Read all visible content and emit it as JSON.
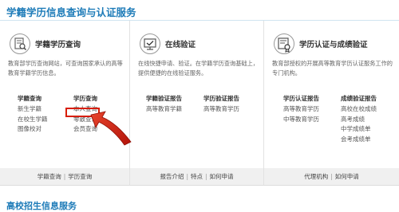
{
  "header": {
    "title": "学籍学历信息查询与认证服务"
  },
  "panels": [
    {
      "title": "学籍学历查询",
      "icon": "document-search-icon",
      "desc": "教育部学历查询网站，可查询国家承认的高等教育学籍学历信息。",
      "columns": [
        {
          "heading": "学籍查询",
          "items": [
            "新生学籍",
            "在校生学籍",
            "图像校对"
          ]
        },
        {
          "heading": "学历查询",
          "items": [
            "本人查询",
            "零散查询",
            "会员查询"
          ]
        }
      ],
      "footer": [
        "学籍查询",
        "学历查询"
      ]
    },
    {
      "title": "在线验证",
      "icon": "monitor-check-icon",
      "desc": "在线快捷申请、验证。在学籍学历查询基础上，提供便捷的在线验证服务。",
      "columns": [
        {
          "heading": "学籍验证报告",
          "items": [
            "高等教育学籍"
          ]
        },
        {
          "heading": "学历验证报告",
          "items": [
            "高等教育学历"
          ]
        }
      ],
      "footer": [
        "报告介绍",
        "特点",
        "如何申请"
      ]
    },
    {
      "title": "学历认证与成绩验证",
      "icon": "certificate-icon",
      "desc": "教育部授权的开展高等教育学历认证服务工作的专门机构。",
      "columns": [
        {
          "heading": "学历认证报告",
          "items": [
            "高等教育学历",
            "中等教育学历"
          ]
        },
        {
          "heading": "成绩验证报告",
          "items": [
            "高校在校成绩",
            "高考成绩",
            "中学成绩单",
            "会考成绩单"
          ]
        }
      ],
      "footer": [
        "代理机构",
        "如何申请"
      ]
    }
  ],
  "next_section": {
    "title": "高校招生信息服务"
  },
  "colors": {
    "brand": "#1d7bb8",
    "highlight": "#d81e06"
  }
}
